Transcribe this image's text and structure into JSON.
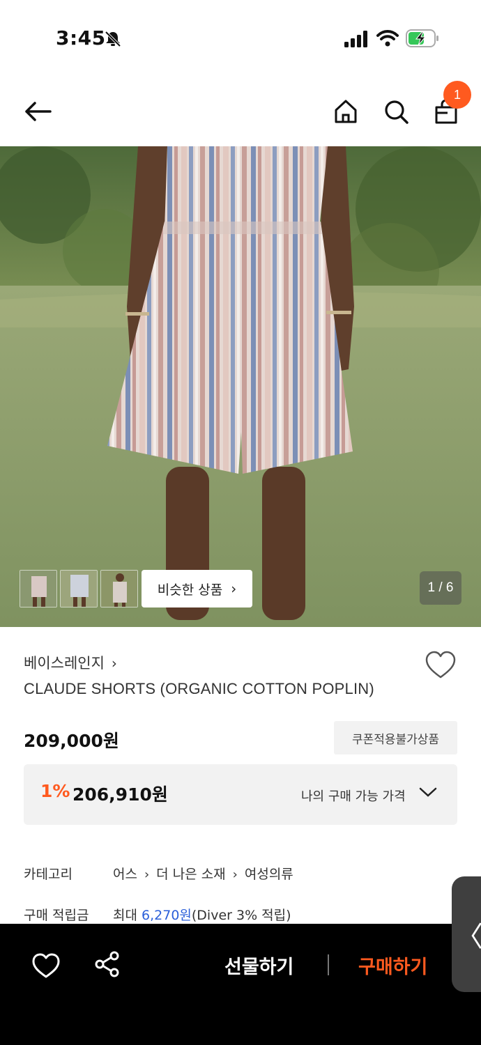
{
  "status_bar": {
    "time": "3:45",
    "icons": [
      "bell-slash-icon",
      "signal-icon",
      "wifi-icon",
      "battery-charging-icon"
    ]
  },
  "nav": {
    "icons": [
      "back-arrow-icon",
      "home-icon",
      "search-icon",
      "shopping-bag-icon"
    ],
    "cart_count": "1"
  },
  "gallery": {
    "similar_label": "비슷한 상품",
    "page_indicator": "1 / 6"
  },
  "product": {
    "brand": "베이스레인지",
    "name": "CLAUDE SHORTS (ORGANIC COTTON POPLIN)",
    "price": "209,000원",
    "coupon_badge": "쿠폰적용불가상품",
    "discount_rate": "1%",
    "my_price": "206,910원",
    "my_price_label": "나의 구매 가능 가격"
  },
  "info": {
    "category_label": "카테고리",
    "category_path": [
      "어스",
      "더 나은 소재",
      "여성의류"
    ],
    "points_label": "구매 적립금",
    "points_prefix": "최대",
    "points_amount": "6,270원",
    "points_suffix": "(Diver 3% 적립)"
  },
  "side_tab": {
    "glyph": "〈"
  },
  "bottom_bar": {
    "gift_label": "선물하기",
    "buy_label": "구매하기"
  },
  "colors": {
    "accent": "#ff5a1f",
    "link_blue": "#2b5fd9"
  }
}
